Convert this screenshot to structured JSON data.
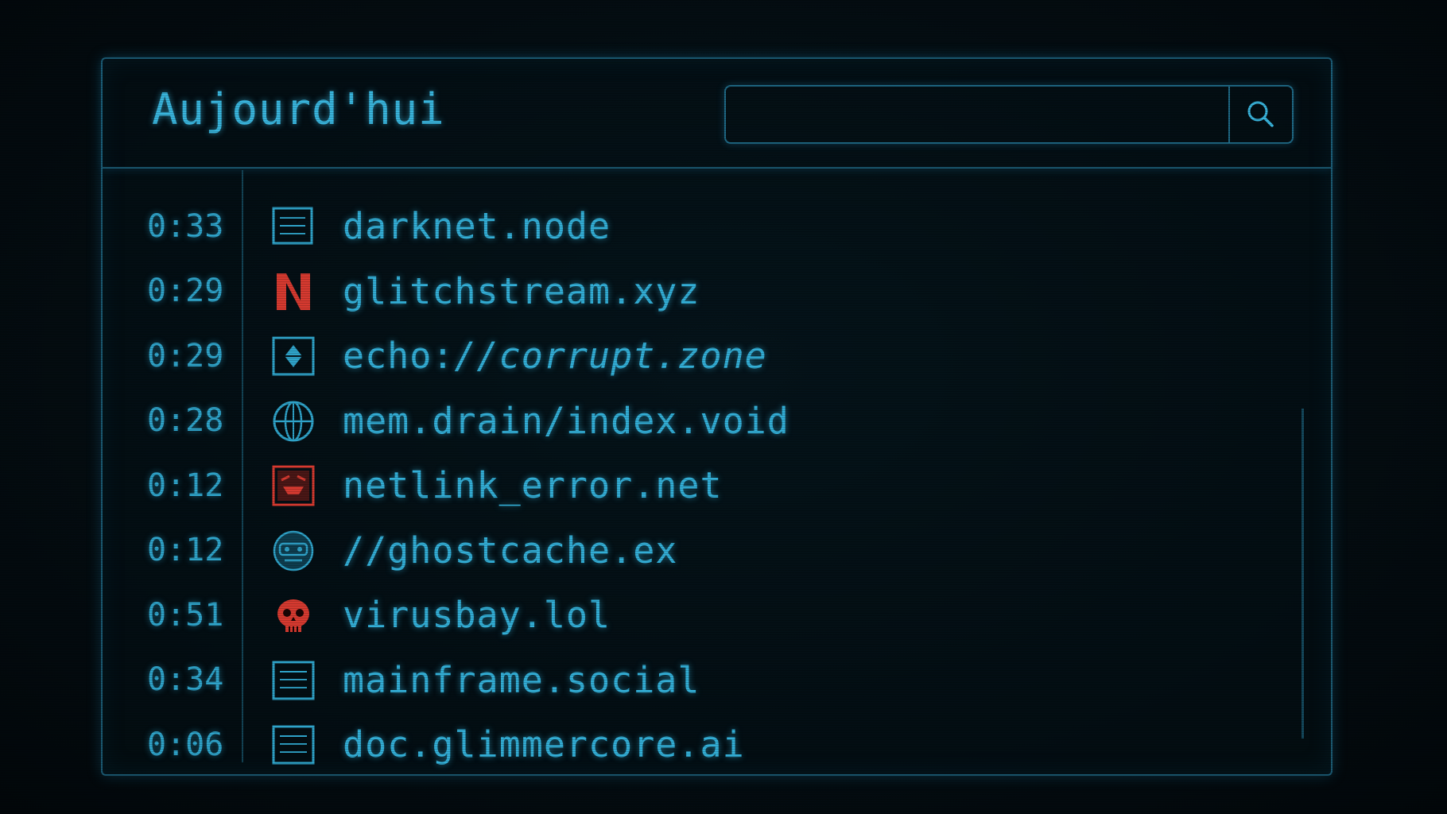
{
  "window": {
    "title": "Aujourd'hui",
    "search": {
      "value": "",
      "placeholder": ""
    }
  },
  "history": [
    {
      "time": "0:33",
      "label": "darknet.node",
      "icon": "document-icon",
      "color": "#2fa3c9"
    },
    {
      "time": "0:29",
      "label": "glitchstream.xyz",
      "icon": "streaming-logo-icon",
      "color": "#d63a30"
    },
    {
      "time": "0:29",
      "label_a": "echo:",
      "label_b": "//corrupt.zone",
      "icon": "diamond-badge-icon",
      "color": "#2fa3c9"
    },
    {
      "time": "0:28",
      "label": "mem.drain/index.void",
      "icon": "globe-icon",
      "color": "#2fa3c9"
    },
    {
      "time": "0:12",
      "label": "netlink_error.net",
      "icon": "error-face-icon",
      "color": "#d63a30"
    },
    {
      "time": "0:12",
      "label": "//ghostcache.ex",
      "icon": "ghost-face-icon",
      "color": "#2fa3c9"
    },
    {
      "time": "0:51",
      "label": "virusbay.lol",
      "icon": "skull-icon",
      "color": "#d63a30"
    },
    {
      "time": "0:34",
      "label": "mainframe.social",
      "icon": "document-icon",
      "color": "#2fa3c9"
    },
    {
      "time": "0:06",
      "label": "doc.glimmercore.ai",
      "icon": "document-icon",
      "color": "#2fa3c9"
    }
  ]
}
